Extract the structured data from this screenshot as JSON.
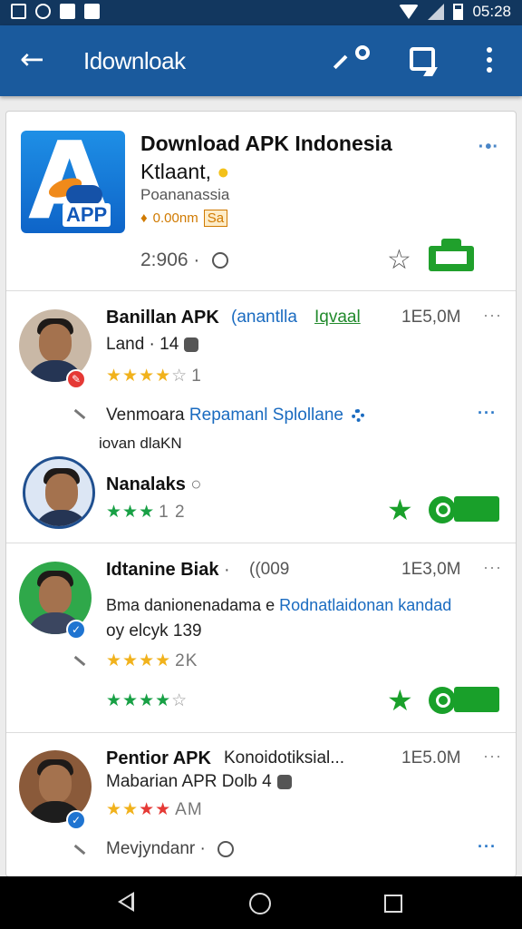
{
  "status_bar": {
    "time": "05:28"
  },
  "app_bar": {
    "title": "Idownloak"
  },
  "app": {
    "title": "Download APK Indonesia",
    "subtitle": "Ktlaant,",
    "developer": "Poananassia",
    "meta": "0.00nm",
    "meta_tag": "Sa",
    "count": "2:906",
    "count_sep": "·"
  },
  "reviews": [
    {
      "name": "Banillan APK",
      "tag": "(anantlla",
      "tag2": "Iqvaal",
      "size": "1E5,0M",
      "line1": "Land · 14",
      "rating_num": "1",
      "comment_a": "Venmoara",
      "comment_b": "Repamanl Splollane",
      "comment_c": "iovan dlaKN"
    },
    {
      "name": "Nanalaks",
      "rating_num": "1 2"
    },
    {
      "name": "Idtanine Biak",
      "tag": "(009",
      "size": "1E3,0M",
      "line1_a": "Bma danionenadama e",
      "line1_b": "Rodnatlaidonan kandad",
      "line2": "oy elcyk 139",
      "rating_num": "2K"
    },
    {
      "name": "Pentior APK",
      "tag": "Konoidotiksial...",
      "size": "1E5.0M",
      "line1": "Mabarian APR Dolb",
      "line1_num": "4",
      "rating_num": "AM",
      "line2": "Mevjyndanr"
    }
  ],
  "colors": {
    "app_bar": "#1a5a9d",
    "status_bar": "#12375f",
    "green": "#19a02a",
    "star": "#f1b21c",
    "link": "#1a6bc0"
  }
}
